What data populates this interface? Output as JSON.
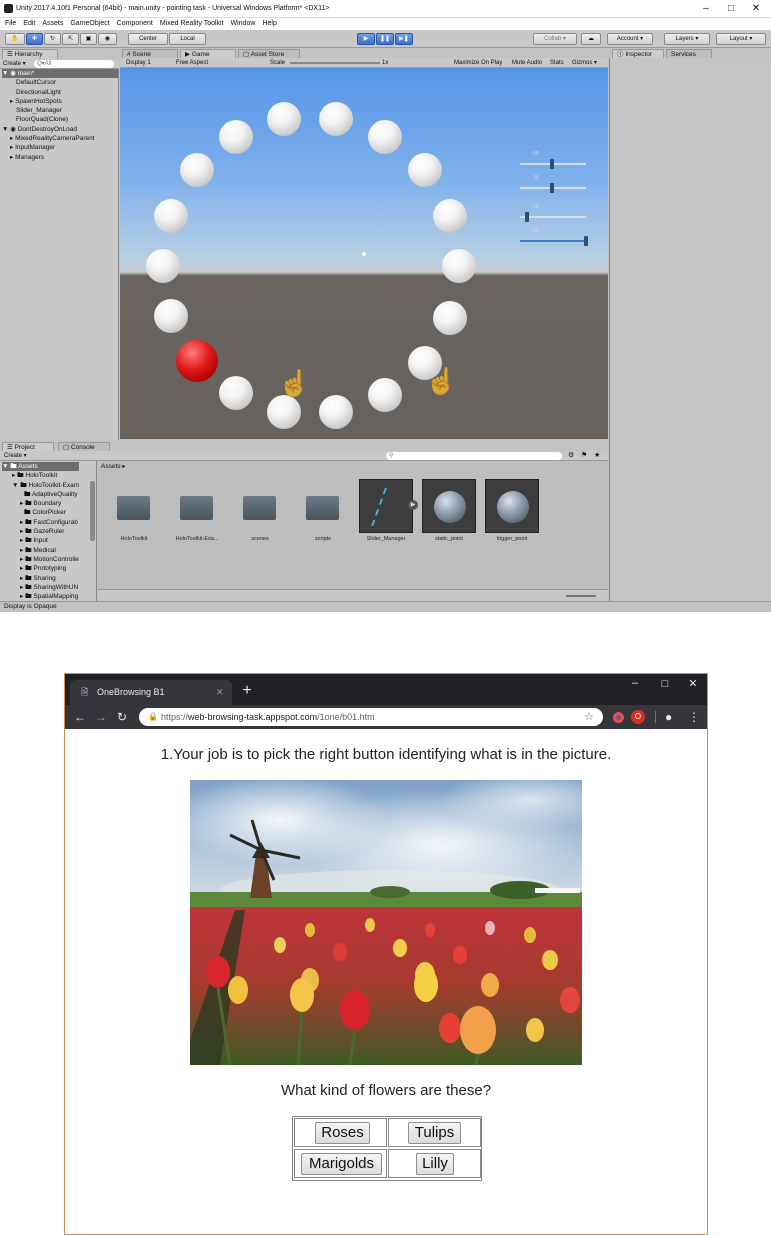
{
  "unity": {
    "window_title": "Unity 2017.4.10f1 Personal (64bit) - main.unity - pointing task - Universal Windows Platform* <DX11>",
    "menu": [
      "File",
      "Edit",
      "Assets",
      "GameObject",
      "Component",
      "Mixed Reality Toolkit",
      "Window",
      "Help"
    ],
    "toolbar": {
      "center": "Center",
      "local": "Local",
      "collab": "Collab ▾",
      "account": "Account ▾",
      "layers": "Layers ▾",
      "layout": "Layout ▾"
    },
    "hierarchy": {
      "tab": "Hierarchy",
      "create": "Create ▾",
      "search_placeholder": "Q▾All",
      "scene": "main*",
      "items": [
        "DefaultCursor",
        "DirectionalLight",
        "SpawnHotSpots",
        "Slider_Manager",
        "FloorQuad(Clone)"
      ],
      "ddol": "DontDestroyOnLoad",
      "ddol_items": [
        "MixedRealityCameraParent",
        "InputManager",
        "Managers"
      ]
    },
    "view_tabs": [
      "Scene",
      "Game",
      "Asset Store"
    ],
    "game_bar": {
      "display": "Display 1",
      "aspect": "Free Aspect",
      "scale_label": "Scale",
      "scale_value": "1x",
      "maximize": "Maximize On Play",
      "mute": "Mute Audio",
      "stats": "Stats",
      "gizmos": "Gizmos ▾"
    },
    "game_sliders": [
      "60",
      "30",
      "20",
      "80"
    ],
    "inspector_tabs": [
      "Inspector",
      "Services"
    ],
    "project": {
      "tabs": [
        "Project",
        "Console"
      ],
      "create": "Create ▾",
      "assets_root": "Assets",
      "tree": [
        "HoloToolkit",
        "HoloToolkit-Exam",
        "AdaptiveQuality",
        "Boundary",
        "ColorPicker",
        "FastConfigurab",
        "GazeRuler",
        "Input",
        "Medical",
        "MotionControlle",
        "Prototyping",
        "Sharing",
        "SharingWithUN",
        "SpatialMapping"
      ],
      "breadcrumb": "Assets ▸",
      "assets": [
        "HoloToolkit",
        "HoloToolkit-Exa...",
        "scenes",
        "scripts",
        "Slider_Manager",
        "static_point",
        "trigger_point"
      ]
    },
    "status": "Display is Opaque"
  },
  "browser": {
    "tab_title": "OneBrowsing B1",
    "url_prefix": "https://",
    "url_host": "web-browsing-task.appspot.com",
    "url_path": "/1one/b01.htm",
    "question": "1.Your job is to pick the right button identifying what is in the picture.",
    "prompt": "What kind of flowers are these?",
    "options": [
      "Roses",
      "Tulips",
      "Marigolds",
      "Lilly"
    ]
  }
}
